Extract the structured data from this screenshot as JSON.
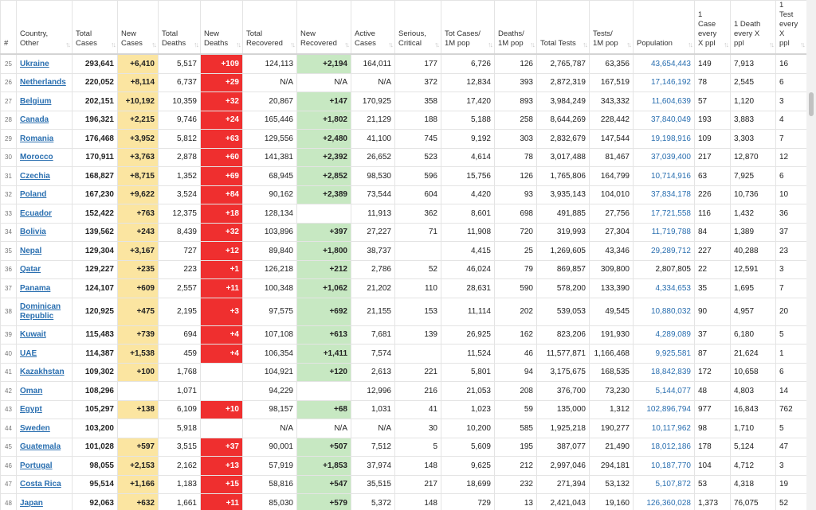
{
  "headers": [
    {
      "key": "num",
      "label": "#"
    },
    {
      "key": "country",
      "label": "Country, Other"
    },
    {
      "key": "total_cases",
      "label": "Total Cases"
    },
    {
      "key": "new_cases",
      "label": "New Cases"
    },
    {
      "key": "total_deaths",
      "label": "Total Deaths"
    },
    {
      "key": "new_deaths",
      "label": "New Deaths"
    },
    {
      "key": "total_recovered",
      "label": "Total Recovered"
    },
    {
      "key": "new_recovered",
      "label": "New Recovered"
    },
    {
      "key": "active_cases",
      "label": "Active Cases"
    },
    {
      "key": "serious",
      "label": "Serious, Critical"
    },
    {
      "key": "cases_per_1m",
      "label": "Tot Cases/ 1M pop"
    },
    {
      "key": "deaths_per_1m",
      "label": "Deaths/ 1M pop"
    },
    {
      "key": "total_tests",
      "label": "Total Tests"
    },
    {
      "key": "tests_per_1m",
      "label": "Tests/ 1M pop"
    },
    {
      "key": "population",
      "label": "Population"
    },
    {
      "key": "case_every",
      "label": "1 Case every X ppl"
    },
    {
      "key": "death_every",
      "label": "1 Death every X ppl"
    },
    {
      "key": "test_every",
      "label": "1 Test every X ppl"
    }
  ],
  "sort_icon": "↑↓",
  "colors": {
    "new_cases_bg": "#fbe5a1",
    "new_deaths_bg": "#ef2f2f",
    "new_recovered_bg": "#c7e8c2",
    "link": "#2a6fb0"
  },
  "rows": [
    [
      "25",
      "Ukraine",
      "293,641",
      "+6,410",
      "5,517",
      "+109",
      "124,113",
      "+2,194",
      "164,011",
      "177",
      "6,726",
      "126",
      "2,765,787",
      "63,356",
      "43,654,443",
      "149",
      "7,913",
      "16"
    ],
    [
      "26",
      "Netherlands",
      "220,052",
      "+8,114",
      "6,737",
      "+29",
      "N/A",
      "N/A",
      "N/A",
      "372",
      "12,834",
      "393",
      "2,872,319",
      "167,519",
      "17,146,192",
      "78",
      "2,545",
      "6"
    ],
    [
      "27",
      "Belgium",
      "202,151",
      "+10,192",
      "10,359",
      "+32",
      "20,867",
      "+147",
      "170,925",
      "358",
      "17,420",
      "893",
      "3,984,249",
      "343,332",
      "11,604,639",
      "57",
      "1,120",
      "3"
    ],
    [
      "28",
      "Canada",
      "196,321",
      "+2,215",
      "9,746",
      "+24",
      "165,446",
      "+1,802",
      "21,129",
      "188",
      "5,188",
      "258",
      "8,644,269",
      "228,442",
      "37,840,049",
      "193",
      "3,883",
      "4"
    ],
    [
      "29",
      "Romania",
      "176,468",
      "+3,952",
      "5,812",
      "+63",
      "129,556",
      "+2,480",
      "41,100",
      "745",
      "9,192",
      "303",
      "2,832,679",
      "147,544",
      "19,198,916",
      "109",
      "3,303",
      "7"
    ],
    [
      "30",
      "Morocco",
      "170,911",
      "+3,763",
      "2,878",
      "+60",
      "141,381",
      "+2,392",
      "26,652",
      "523",
      "4,614",
      "78",
      "3,017,488",
      "81,467",
      "37,039,400",
      "217",
      "12,870",
      "12"
    ],
    [
      "31",
      "Czechia",
      "168,827",
      "+8,715",
      "1,352",
      "+69",
      "68,945",
      "+2,852",
      "98,530",
      "596",
      "15,756",
      "126",
      "1,765,806",
      "164,799",
      "10,714,916",
      "63",
      "7,925",
      "6"
    ],
    [
      "32",
      "Poland",
      "167,230",
      "+9,622",
      "3,524",
      "+84",
      "90,162",
      "+2,389",
      "73,544",
      "604",
      "4,420",
      "93",
      "3,935,143",
      "104,010",
      "37,834,178",
      "226",
      "10,736",
      "10"
    ],
    [
      "33",
      "Ecuador",
      "152,422",
      "+763",
      "12,375",
      "+18",
      "128,134",
      "",
      "11,913",
      "362",
      "8,601",
      "698",
      "491,885",
      "27,756",
      "17,721,558",
      "116",
      "1,432",
      "36"
    ],
    [
      "34",
      "Bolivia",
      "139,562",
      "+243",
      "8,439",
      "+32",
      "103,896",
      "+397",
      "27,227",
      "71",
      "11,908",
      "720",
      "319,993",
      "27,304",
      "11,719,788",
      "84",
      "1,389",
      "37"
    ],
    [
      "35",
      "Nepal",
      "129,304",
      "+3,167",
      "727",
      "+12",
      "89,840",
      "+1,800",
      "38,737",
      "",
      "4,415",
      "25",
      "1,269,605",
      "43,346",
      "29,289,712",
      "227",
      "40,288",
      "23"
    ],
    [
      "36",
      "Qatar",
      "129,227",
      "+235",
      "223",
      "+1",
      "126,218",
      "+212",
      "2,786",
      "52",
      "46,024",
      "79",
      "869,857",
      "309,800",
      "2,807,805",
      "22",
      "12,591",
      "3"
    ],
    [
      "37",
      "Panama",
      "124,107",
      "+609",
      "2,557",
      "+11",
      "100,348",
      "+1,062",
      "21,202",
      "110",
      "28,631",
      "590",
      "578,200",
      "133,390",
      "4,334,653",
      "35",
      "1,695",
      "7"
    ],
    [
      "38",
      "Dominican Republic",
      "120,925",
      "+475",
      "2,195",
      "+3",
      "97,575",
      "+692",
      "21,155",
      "153",
      "11,114",
      "202",
      "539,053",
      "49,545",
      "10,880,032",
      "90",
      "4,957",
      "20"
    ],
    [
      "39",
      "Kuwait",
      "115,483",
      "+739",
      "694",
      "+4",
      "107,108",
      "+613",
      "7,681",
      "139",
      "26,925",
      "162",
      "823,206",
      "191,930",
      "4,289,089",
      "37",
      "6,180",
      "5"
    ],
    [
      "40",
      "UAE",
      "114,387",
      "+1,538",
      "459",
      "+4",
      "106,354",
      "+1,411",
      "7,574",
      "",
      "11,524",
      "46",
      "11,577,871",
      "1,166,468",
      "9,925,581",
      "87",
      "21,624",
      "1"
    ],
    [
      "41",
      "Kazakhstan",
      "109,302",
      "+100",
      "1,768",
      "",
      "104,921",
      "+120",
      "2,613",
      "221",
      "5,801",
      "94",
      "3,175,675",
      "168,535",
      "18,842,839",
      "172",
      "10,658",
      "6"
    ],
    [
      "42",
      "Oman",
      "108,296",
      "",
      "1,071",
      "",
      "94,229",
      "",
      "12,996",
      "216",
      "21,053",
      "208",
      "376,700",
      "73,230",
      "5,144,077",
      "48",
      "4,803",
      "14"
    ],
    [
      "43",
      "Egypt",
      "105,297",
      "+138",
      "6,109",
      "+10",
      "98,157",
      "+68",
      "1,031",
      "41",
      "1,023",
      "59",
      "135,000",
      "1,312",
      "102,896,794",
      "977",
      "16,843",
      "762"
    ],
    [
      "44",
      "Sweden",
      "103,200",
      "",
      "5,918",
      "",
      "N/A",
      "N/A",
      "N/A",
      "30",
      "10,200",
      "585",
      "1,925,218",
      "190,277",
      "10,117,962",
      "98",
      "1,710",
      "5"
    ],
    [
      "45",
      "Guatemala",
      "101,028",
      "+597",
      "3,515",
      "+37",
      "90,001",
      "+507",
      "7,512",
      "5",
      "5,609",
      "195",
      "387,077",
      "21,490",
      "18,012,186",
      "178",
      "5,124",
      "47"
    ],
    [
      "46",
      "Portugal",
      "98,055",
      "+2,153",
      "2,162",
      "+13",
      "57,919",
      "+1,853",
      "37,974",
      "148",
      "9,625",
      "212",
      "2,997,046",
      "294,181",
      "10,187,770",
      "104",
      "4,712",
      "3"
    ],
    [
      "47",
      "Costa Rica",
      "95,514",
      "+1,166",
      "1,183",
      "+15",
      "58,816",
      "+547",
      "35,515",
      "217",
      "18,699",
      "232",
      "271,394",
      "53,132",
      "5,107,872",
      "53",
      "4,318",
      "19"
    ],
    [
      "48",
      "Japan",
      "92,063",
      "+632",
      "1,661",
      "+11",
      "85,030",
      "+579",
      "5,372",
      "148",
      "729",
      "13",
      "2,421,043",
      "19,160",
      "126,360,028",
      "1,373",
      "76,075",
      "52"
    ]
  ]
}
